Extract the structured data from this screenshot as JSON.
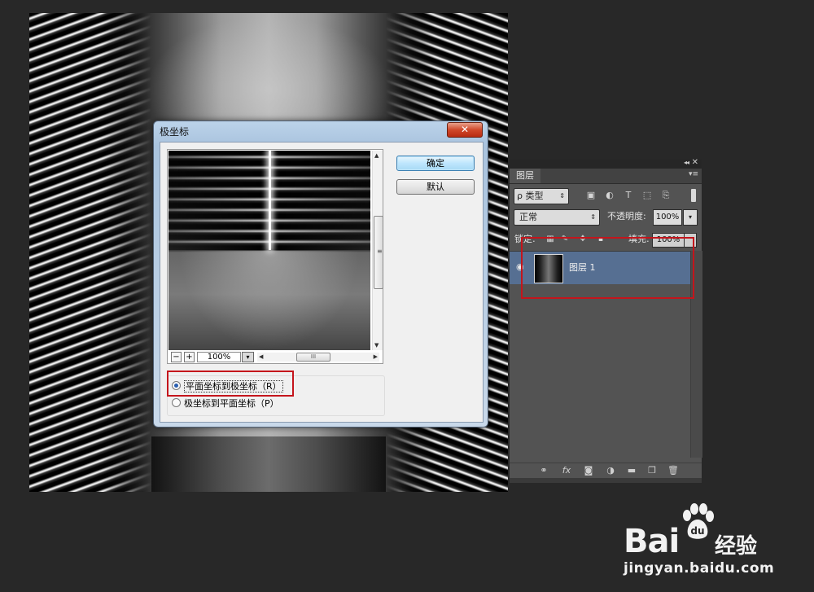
{
  "dialog": {
    "title": "极坐标",
    "close_glyph": "✕",
    "ok_label": "确定",
    "default_label": "默认",
    "zoom": {
      "minus": "−",
      "plus": "+",
      "value": "100%",
      "dropdown": "▾"
    },
    "scroll_grip": "≡",
    "hscroll_grip": "III",
    "options": [
      {
        "label": "平面坐标到极坐标（R）",
        "selected": true
      },
      {
        "label": "极坐标到平面坐标（P）",
        "selected": false
      }
    ]
  },
  "layers_panel": {
    "collapse_glyph": "◂◂",
    "close_glyph": "✕",
    "tab_label": "图层",
    "menu_glyph": "▾≡",
    "filter": {
      "label": "类型",
      "search_glyph": "ρ",
      "arrow": "⇕"
    },
    "filter_icons": [
      "image-filter-icon",
      "adjustment-filter-icon",
      "type-filter-icon",
      "shape-filter-icon",
      "smart-object-filter-icon"
    ],
    "blend_mode": "正常",
    "blend_arrow": "⇕",
    "opacity_label": "不透明度:",
    "opacity_value": "100%",
    "opacity_arrow": "▾",
    "lock_label": "锁定:",
    "fill_label": "填充:",
    "fill_value": "100%",
    "layer": {
      "name": "图层 1",
      "eye_glyph": "◉"
    },
    "footer_icons": [
      "link-icon",
      "fx-icon",
      "mask-icon",
      "adjustment-icon",
      "folder-icon",
      "new-layer-icon",
      "trash-icon"
    ]
  },
  "watermark": {
    "brand": "Bai",
    "brand_suffix": "经验",
    "url": "jingyan.baidu.com"
  },
  "colors": {
    "highlight": "#c4151c",
    "selected_layer": "#566f92",
    "panel_bg": "#535353",
    "app_bg": "#282828"
  }
}
